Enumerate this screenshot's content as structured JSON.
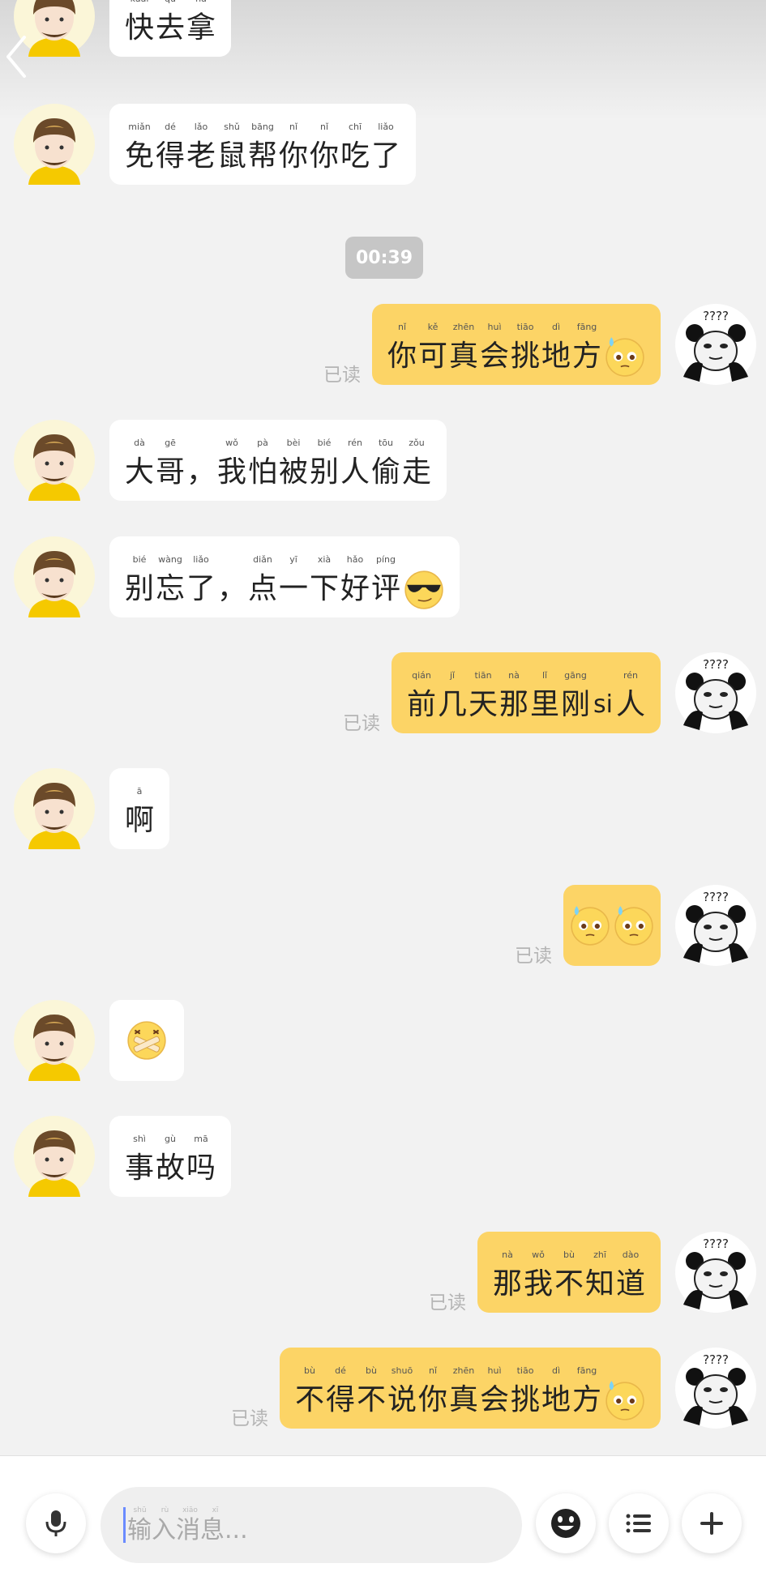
{
  "time_divider": "00:39",
  "read_label": "已读",
  "input": {
    "placeholder_pinyin": [
      "shū",
      "rù",
      "xiāo",
      "xī"
    ],
    "placeholder": "输入消息..."
  },
  "messages": [
    {
      "side": "left",
      "pinyin": [
        "kuài",
        "qù",
        "ná"
      ],
      "chars": [
        "快",
        "去",
        "拿"
      ]
    },
    {
      "side": "left",
      "pinyin": [
        "miǎn",
        "dé",
        "lǎo",
        "shǔ",
        "bāng",
        "nǐ",
        "nǐ",
        "chī",
        "liǎo"
      ],
      "chars": [
        "免",
        "得",
        "老",
        "鼠",
        "帮",
        "你",
        "你",
        "吃",
        "了"
      ]
    },
    {
      "side": "right",
      "pinyin": [
        "nǐ",
        "kě",
        "zhēn",
        "huì",
        "tiāo",
        "dì",
        "fāng"
      ],
      "chars": [
        "你",
        "可",
        "真",
        "会",
        "挑",
        "地",
        "方"
      ],
      "emoji": "sweat-pleading-emoji",
      "read": true
    },
    {
      "side": "left",
      "pinyin": [
        "dà",
        "gē",
        "",
        "wǒ",
        "pà",
        "bèi",
        "bié",
        "rén",
        "tōu",
        "zǒu"
      ],
      "chars": [
        "大",
        "哥",
        "，",
        "我",
        "怕",
        "被",
        "别",
        "人",
        "偷",
        "走"
      ]
    },
    {
      "side": "left",
      "pinyin": [
        "bié",
        "wàng",
        "liǎo",
        "",
        "diǎn",
        "yī",
        "xià",
        "hǎo",
        "píng"
      ],
      "chars": [
        "别",
        "忘",
        "了",
        "，",
        "点",
        "一",
        "下",
        "好",
        "评"
      ],
      "emoji": "sunglasses-emoji"
    },
    {
      "side": "right",
      "pinyin": [
        "qián",
        "jǐ",
        "tiān",
        "nà",
        "lǐ",
        "gāng",
        "",
        "rén"
      ],
      "chars": [
        "前",
        "几",
        "天",
        "那",
        "里",
        "刚",
        "si",
        "人"
      ],
      "read": true
    },
    {
      "side": "left",
      "pinyin": [
        "ā"
      ],
      "chars": [
        "啊"
      ]
    },
    {
      "side": "right",
      "sticker": "double-pleading-emoji",
      "read": true
    },
    {
      "side": "left",
      "sticker": "bandaged-face-emoji"
    },
    {
      "side": "left",
      "pinyin": [
        "shì",
        "gù",
        "mā"
      ],
      "chars": [
        "事",
        "故",
        "吗"
      ]
    },
    {
      "side": "right",
      "pinyin": [
        "nà",
        "wǒ",
        "bù",
        "zhī",
        "dào"
      ],
      "chars": [
        "那",
        "我",
        "不",
        "知",
        "道"
      ],
      "read": true
    },
    {
      "side": "right",
      "pinyin": [
        "bù",
        "dé",
        "bù",
        "shuō",
        "nǐ",
        "zhēn",
        "huì",
        "tiāo",
        "dì",
        "fāng"
      ],
      "chars": [
        "不",
        "得",
        "不",
        "说",
        "你",
        "真",
        "会",
        "挑",
        "地",
        "方"
      ],
      "emoji": "sweat-pleading-emoji",
      "read": true
    }
  ],
  "icons": {
    "back": "chevron-left-icon",
    "voice": "microphone-icon",
    "emoji_picker": "smiley-icon",
    "menu": "list-icon",
    "more": "plus-icon",
    "bot_avatar": "courier-avatar",
    "user_avatar": "panda-meme-avatar"
  },
  "colors": {
    "left_bubble": "#ffffff",
    "right_bubble": "#fcd466",
    "background": "#f2f2f2",
    "read_text": "#b5b5b5",
    "time_badge": "#c6c6c6"
  }
}
